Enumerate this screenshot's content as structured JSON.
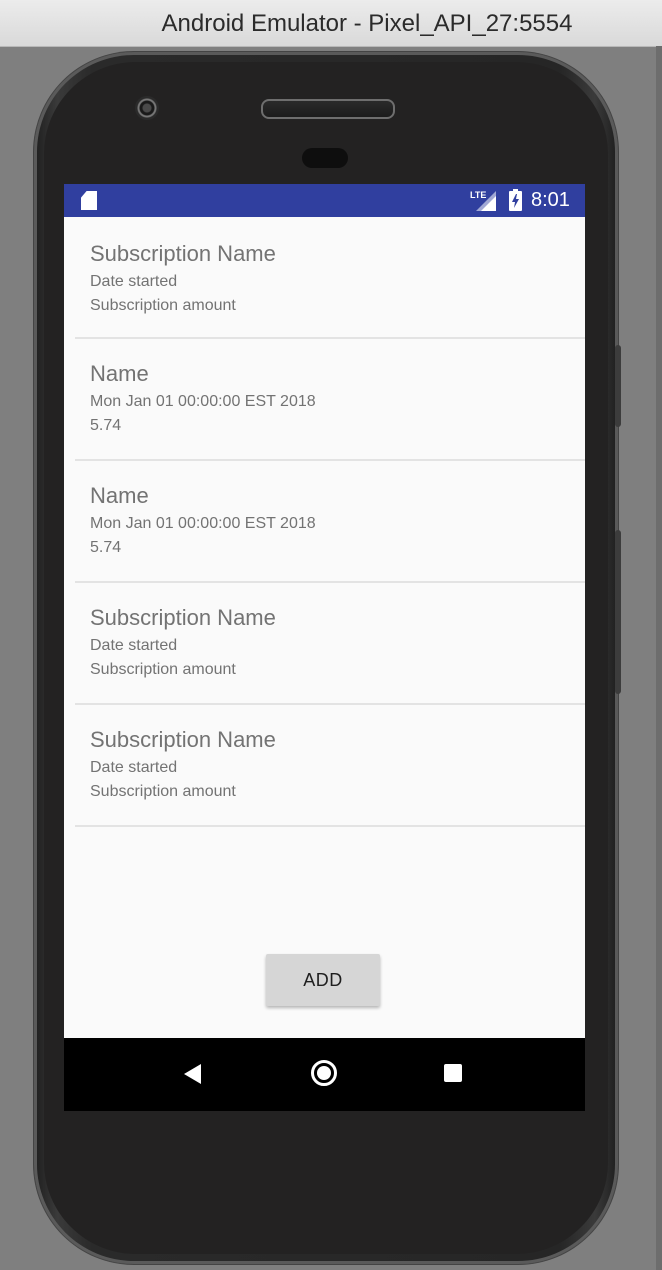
{
  "window": {
    "title": "Android Emulator - Pixel_API_27:5554"
  },
  "status_bar": {
    "network": "LTE",
    "time": "8:01"
  },
  "subscriptions": [
    {
      "name": "Subscription Name",
      "date": "Date started",
      "amount": "Subscription amount"
    },
    {
      "name": "Name",
      "date": "Mon Jan 01 00:00:00 EST 2018",
      "amount": "5.74"
    },
    {
      "name": "Name",
      "date": "Mon Jan 01 00:00:00 EST 2018",
      "amount": "5.74"
    },
    {
      "name": "Subscription Name",
      "date": "Date started",
      "amount": "Subscription amount"
    },
    {
      "name": "Subscription Name",
      "date": "Date started",
      "amount": "Subscription amount"
    }
  ],
  "actions": {
    "add_label": "ADD"
  },
  "nav_bar": {
    "back_icon": "back-triangle-icon",
    "home_icon": "home-circle-icon",
    "recents_icon": "recents-square-icon"
  },
  "colors": {
    "status_bar": "#303f9f",
    "background": "#fafafa",
    "text": "#737373",
    "button": "#d6d6d6"
  }
}
